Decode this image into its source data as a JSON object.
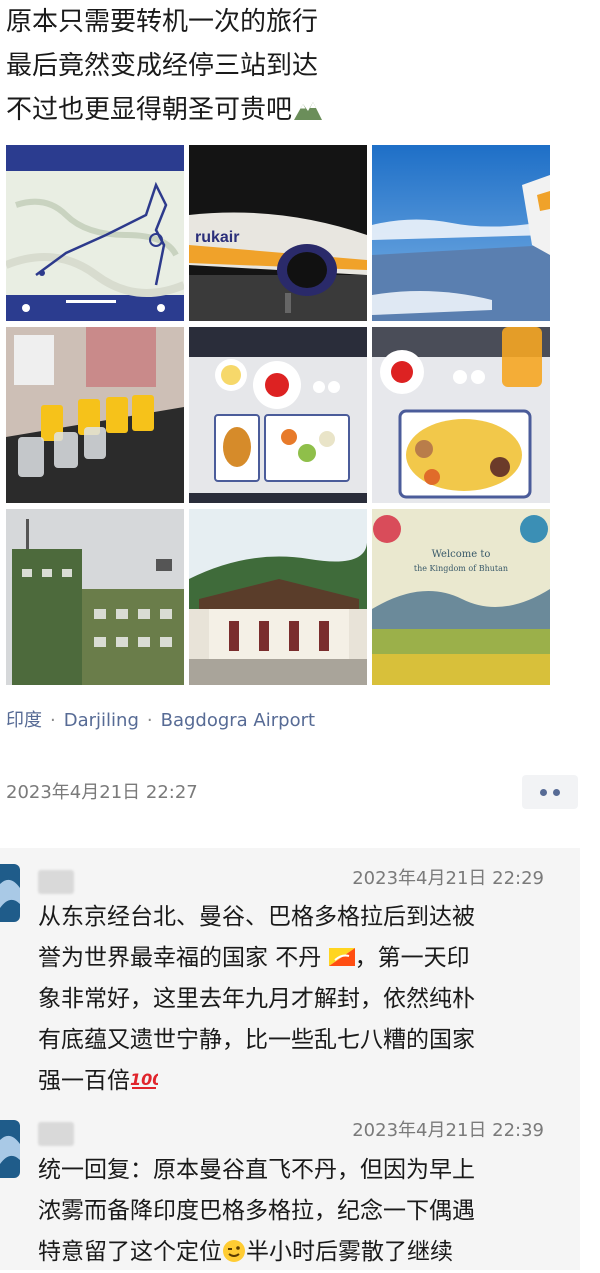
{
  "post": {
    "lines": [
      "原本只需要转机一次的旅行",
      "最后竟然变成经停三站到达",
      "不过也更显得朝圣可贵吧"
    ],
    "emoji": "mountain"
  },
  "location": {
    "parts": [
      "印度",
      "Darjiling",
      "Bagdogra Airport"
    ]
  },
  "timestamp": "2023年4月21日 22:27",
  "comments": [
    {
      "time": "2023年4月21日 22:29",
      "lines": [
        "从东京经台北、曼谷、巴格多格拉后到达被",
        "誉为世界最幸福的国家 不丹",
        "，第一天印",
        "象非常好，这里去年九月才解封，依然纯朴",
        "有底蕴又遗世宁静，比一些乱七八糟的国家",
        "强一百倍"
      ]
    },
    {
      "time": "2023年4月21日 22:39",
      "lines": [
        "统一回复：原本曼谷直飞不丹，但因为早上",
        "浓雾而备降印度巴格多格拉，纪念一下偶遇",
        "特意留了这个定位",
        "半小时后雾散了继续"
      ]
    }
  ],
  "photo_texts": {
    "tail_logo": "rukair",
    "welcome_line1": "Welcome to",
    "welcome_line2": "the Kingdom of Bhutan"
  },
  "icons": [
    "mountain-emoji",
    "bhutan-flag-emoji",
    "hundred-points-emoji",
    "winking-face-emoji",
    "more-options-icon"
  ],
  "colors": {
    "link": "#576b95",
    "meta": "#7a7a7a",
    "comment_bg": "#f5f5f5"
  }
}
